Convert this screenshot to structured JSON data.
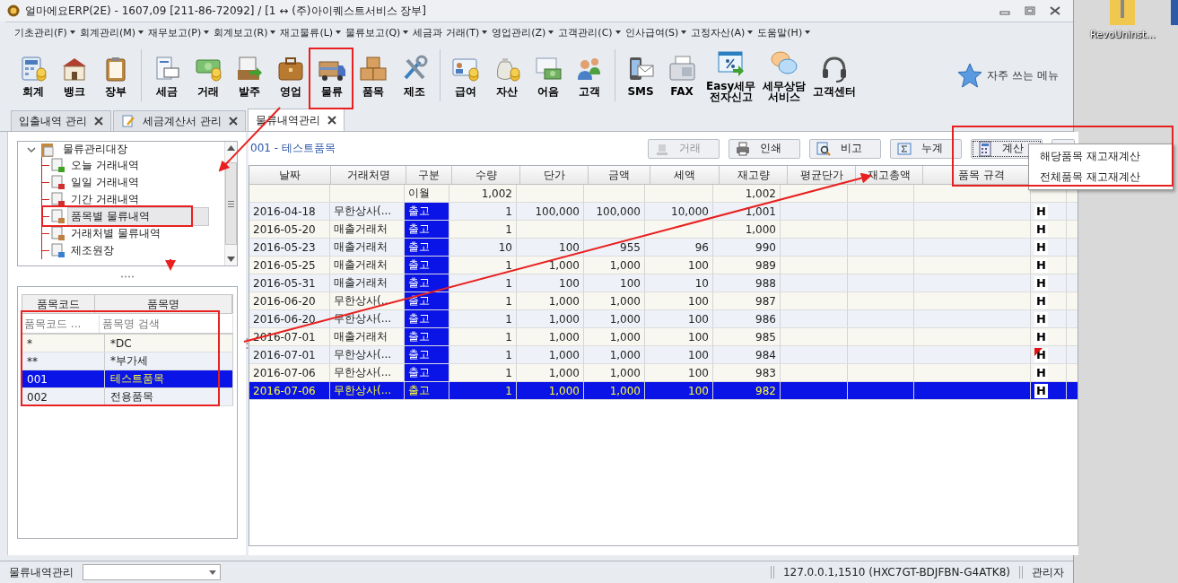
{
  "window": {
    "title": "얼마에요ERP(2E) - 1607,09 [211-86-72092] / [1 ↔ (주)아이퀘스트서비스 장부]"
  },
  "menu": [
    "기초관리(F)",
    "회계관리(M)",
    "재무보고(P)",
    "회계보고(R)",
    "재고물류(L)",
    "물류보고(Q)",
    "세금과 거래(T)",
    "영업관리(Z)",
    "고객관리(C)",
    "인사급여(S)",
    "고정자산(A)",
    "도움말(H)"
  ],
  "toolbar": {
    "groups": [
      [
        {
          "label": "회계"
        },
        {
          "label": "뱅크"
        },
        {
          "label": "장부"
        }
      ],
      [
        {
          "label": "세금"
        },
        {
          "label": "거래"
        },
        {
          "label": "발주"
        },
        {
          "label": "영업"
        },
        {
          "label": "물류"
        },
        {
          "label": "품목"
        },
        {
          "label": "제조"
        }
      ],
      [
        {
          "label": "급여"
        },
        {
          "label": "자산"
        },
        {
          "label": "어음"
        },
        {
          "label": "고객"
        }
      ],
      [
        {
          "label": "SMS"
        },
        {
          "label": "FAX"
        },
        {
          "label": "Easy세무 전자신고"
        },
        {
          "label": "세무상담 서비스"
        },
        {
          "label": "고객센터"
        }
      ]
    ],
    "favorites": "자주 쓰는 메뉴"
  },
  "tabs": [
    {
      "label": "입출내역 관리",
      "selected": false
    },
    {
      "label": "세금계산서 관리",
      "selected": false
    },
    {
      "label": "물류내역관리",
      "selected": true
    }
  ],
  "tree": {
    "label": "물류관리대장",
    "expanded": true,
    "children": [
      {
        "label": "오늘 거래내역",
        "selected": false
      },
      {
        "label": "일일 거래내역",
        "selected": false
      },
      {
        "label": "기간 거래내역",
        "selected": false
      },
      {
        "label": "품목별 물류내역",
        "selected": true
      },
      {
        "label": "거래처별 물류내역",
        "selected": false
      },
      {
        "label": "제조원장",
        "selected": false
      }
    ]
  },
  "item_list": {
    "columns": [
      "품목코드",
      "품목명"
    ],
    "search": {
      "code_placeholder": "품목코드 ...",
      "name_placeholder": "품목명 검색"
    },
    "rows": [
      {
        "code": "*",
        "name": "*DC",
        "selected": false
      },
      {
        "code": "**",
        "name": "*부가세",
        "selected": false
      },
      {
        "code": "001",
        "name": "테스트품목",
        "selected": true
      },
      {
        "code": "002",
        "name": "전용품목",
        "selected": false
      }
    ]
  },
  "ledger": {
    "caption": "001 - 테스트품목",
    "buttons": [
      {
        "label": "거래",
        "disabled": true,
        "focused": false
      },
      {
        "label": "인쇄",
        "disabled": false,
        "focused": false
      },
      {
        "label": "비고",
        "disabled": false,
        "focused": false
      },
      {
        "label": "누계",
        "disabled": false,
        "focused": false
      },
      {
        "label": "계산",
        "disabled": false,
        "focused": true
      }
    ],
    "columns": [
      "날짜",
      "거래처명",
      "구분",
      "수량",
      "단가",
      "금액",
      "세액",
      "재고량",
      "평균단가",
      "재고총액",
      "품목 규격"
    ],
    "rows": [
      {
        "kind": "carryover",
        "selected": false,
        "type": "이월",
        "qty": "1,002",
        "stock": "1,002"
      },
      {
        "kind": "entry",
        "selected": false,
        "flagged": false,
        "date": "2016-04-18",
        "partner": "무한상사(...",
        "type": "출고",
        "qty": "1",
        "price": "100,000",
        "amount": "100,000",
        "tax": "10,000",
        "stock": "1,001",
        "mark": "H"
      },
      {
        "kind": "entry",
        "selected": false,
        "flagged": false,
        "date": "2016-05-20",
        "partner": "매출거래처",
        "type": "출고",
        "qty": "1",
        "stock": "1,000",
        "mark": "H"
      },
      {
        "kind": "entry",
        "selected": false,
        "flagged": false,
        "date": "2016-05-23",
        "partner": "매출거래처",
        "type": "출고",
        "qty": "10",
        "price": "100",
        "amount": "955",
        "tax": "96",
        "stock": "990",
        "mark": "H"
      },
      {
        "kind": "entry",
        "selected": false,
        "flagged": false,
        "date": "2016-05-25",
        "partner": "매출거래처",
        "type": "출고",
        "qty": "1",
        "price": "1,000",
        "amount": "1,000",
        "tax": "100",
        "stock": "989",
        "mark": "H"
      },
      {
        "kind": "entry",
        "selected": false,
        "flagged": false,
        "date": "2016-05-31",
        "partner": "매출거래처",
        "type": "출고",
        "qty": "1",
        "price": "100",
        "amount": "100",
        "tax": "10",
        "stock": "988",
        "mark": "H"
      },
      {
        "kind": "entry",
        "selected": false,
        "flagged": false,
        "date": "2016-06-20",
        "partner": "무한상사(...",
        "type": "출고",
        "qty": "1",
        "price": "1,000",
        "amount": "1,000",
        "tax": "100",
        "stock": "987",
        "mark": "H"
      },
      {
        "kind": "entry",
        "selected": false,
        "flagged": false,
        "date": "2016-06-20",
        "partner": "무한상사(...",
        "type": "출고",
        "qty": "1",
        "price": "1,000",
        "amount": "1,000",
        "tax": "100",
        "stock": "986",
        "mark": "H"
      },
      {
        "kind": "entry",
        "selected": false,
        "flagged": false,
        "date": "2016-07-01",
        "partner": "매출거래처",
        "type": "출고",
        "qty": "1",
        "price": "1,000",
        "amount": "1,000",
        "tax": "100",
        "stock": "985",
        "mark": "H"
      },
      {
        "kind": "entry",
        "selected": false,
        "flagged": true,
        "date": "2016-07-01",
        "partner": "무한상사(...",
        "type": "출고",
        "qty": "1",
        "price": "1,000",
        "amount": "1,000",
        "tax": "100",
        "stock": "984",
        "mark": "H"
      },
      {
        "kind": "entry",
        "selected": false,
        "flagged": false,
        "date": "2016-07-06",
        "partner": "무한상사(...",
        "type": "출고",
        "qty": "1",
        "price": "1,000",
        "amount": "1,000",
        "tax": "100",
        "stock": "983",
        "mark": "H"
      },
      {
        "kind": "entry",
        "selected": true,
        "flagged": false,
        "date": "2016-07-06",
        "partner": "무한상사(...",
        "type": "출고",
        "qty": "1",
        "price": "1,000",
        "amount": "1,000",
        "tax": "100",
        "stock": "982",
        "mark": "H"
      }
    ]
  },
  "context_menu": {
    "items": [
      "해당품목 재고재계산",
      "전체품목 재고재계산"
    ]
  },
  "status_bar": {
    "module": "물류내역관리",
    "connection": "127.0.0.1,1510 (HXC7GT-BDJFBN-G4ATK8)",
    "user": "관리자"
  },
  "desktop": {
    "icons": [
      {
        "label": "RevoUninst..."
      }
    ]
  }
}
